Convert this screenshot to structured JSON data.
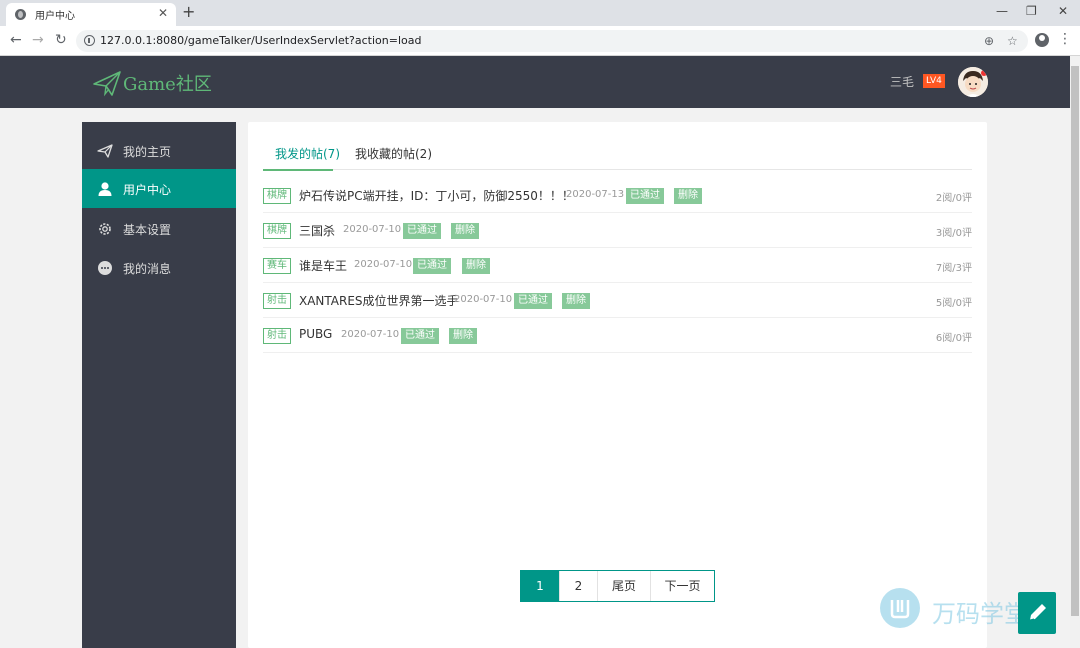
{
  "browser": {
    "tab_title": "用户中心",
    "tab_close": "✕",
    "new_tab": "+",
    "url": "127.0.0.1:8080/gameTalker/UserIndexServlet?action=load",
    "win_min": "—",
    "win_max": "❐",
    "win_close": "✕",
    "back": "←",
    "forward": "→",
    "reload": "↻",
    "zoom": "⊕",
    "star": "☆",
    "menu": "⋮"
  },
  "header": {
    "logo_text": "Game社区",
    "user_name": "三毛",
    "level": "LV4"
  },
  "sidebar": {
    "items": [
      {
        "label": "我的主页",
        "icon": "paper-plane-icon"
      },
      {
        "label": "用户中心",
        "icon": "user-icon"
      },
      {
        "label": "基本设置",
        "icon": "gear-icon"
      },
      {
        "label": "我的消息",
        "icon": "chat-bubble-icon"
      }
    ],
    "active_index": 1
  },
  "content": {
    "tabs": [
      {
        "label": "我发的帖(7)"
      },
      {
        "label": "我收藏的帖(2)"
      }
    ],
    "posts": [
      {
        "category": "棋牌",
        "title": "炉石传说PC端开挂，ID：丁小可，防御2550！！！",
        "date": "2020-07-13",
        "status": "已通过",
        "action": "删除",
        "stats": "2阅/0评"
      },
      {
        "category": "棋牌",
        "title": "三国杀",
        "date": "2020-07-10",
        "status": "已通过",
        "action": "删除",
        "stats": "3阅/0评"
      },
      {
        "category": "赛车",
        "title": "谁是车王",
        "date": "2020-07-10",
        "status": "已通过",
        "action": "删除",
        "stats": "7阅/3评"
      },
      {
        "category": "射击",
        "title": "XANTARES成位世界第一选手",
        "date": "2020-07-10",
        "status": "已通过",
        "action": "删除",
        "stats": "5阅/0评"
      },
      {
        "category": "射击",
        "title": "PUBG",
        "date": "2020-07-10",
        "status": "已通过",
        "action": "删除",
        "stats": "6阅/0评"
      }
    ],
    "pagination": [
      {
        "label": "1"
      },
      {
        "label": "2"
      },
      {
        "label": "尾页"
      },
      {
        "label": "下一页"
      }
    ],
    "current_page": "1"
  },
  "watermark": {
    "text": "万码学堂"
  },
  "colors": {
    "primary": "#009688",
    "green": "#5fb878",
    "header_bg": "#393d49",
    "badge_orange": "#ff5722"
  }
}
